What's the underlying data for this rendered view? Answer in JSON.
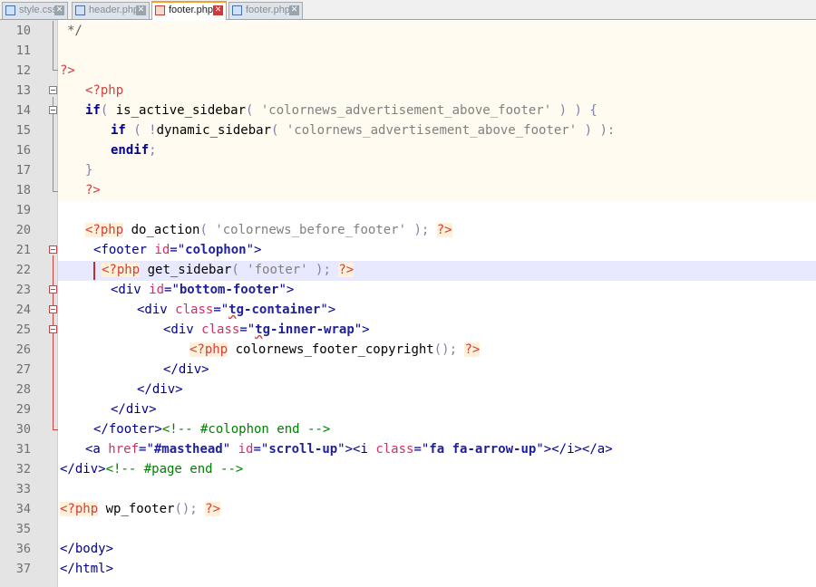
{
  "tabs": [
    {
      "label": "style.css",
      "active": false
    },
    {
      "label": "header.php",
      "active": false
    },
    {
      "label": "footer.php",
      "active": true
    },
    {
      "label": "footer.php",
      "active": false
    }
  ],
  "line_numbers": [
    "10",
    "11",
    "12",
    "13",
    "14",
    "15",
    "16",
    "17",
    "18",
    "19",
    "20",
    "21",
    "22",
    "23",
    "24",
    "25",
    "26",
    "27",
    "28",
    "29",
    "30",
    "31",
    "32",
    "33",
    "34",
    "35",
    "36",
    "37"
  ],
  "code": {
    "l10": {
      "a": "*/"
    },
    "l12": {
      "a": "?>"
    },
    "l13": {
      "a": "<?php"
    },
    "l14": {
      "a": "if",
      "b": "( ",
      "c": "is_active_sidebar",
      "d": "( ",
      "e": "'colornews_advertisement_above_footer'",
      "f": " ) ) {"
    },
    "l15": {
      "a": "if",
      "b": " ( !",
      "c": "dynamic_sidebar",
      "d": "( ",
      "e": "'colornews_advertisement_above_footer'",
      "f": " ) ):"
    },
    "l16": {
      "a": "endif",
      "b": ";"
    },
    "l17": {
      "a": "}"
    },
    "l18": {
      "a": "?>"
    },
    "l20": {
      "a": "<?php",
      "b": " do_action",
      "c": "( ",
      "d": "'colornews_before_footer'",
      "e": " ); ",
      "f": "?>"
    },
    "l21": {
      "a": "<footer ",
      "b": "id",
      "c": "=\"",
      "d": "colophon",
      "e": "\">"
    },
    "l22": {
      "a": "<?php",
      "b": " get_sidebar",
      "c": "( ",
      "d": "'footer'",
      "e": " ); ",
      "f": "?>"
    },
    "l23": {
      "a": "<div ",
      "b": "id",
      "c": "=\"",
      "d": "bottom-footer",
      "e": "\">"
    },
    "l24": {
      "a": "<div ",
      "b": "class",
      "c": "=\"",
      "d": "tg",
      "e": "-container",
      "f": "\">"
    },
    "l25": {
      "a": "<div ",
      "b": "class",
      "c": "=\"",
      "d": "tg",
      "e": "-inner-wrap",
      "f": "\">"
    },
    "l26": {
      "a": "<?php",
      "b": " colornews_footer_copyright",
      "c": "(); ",
      "d": "?>"
    },
    "l27": {
      "a": "</div>"
    },
    "l28": {
      "a": "</div>"
    },
    "l29": {
      "a": "</div>"
    },
    "l30": {
      "a": "</footer>",
      "b": "<!-- #colophon end -->"
    },
    "l31": {
      "a": "<a ",
      "b": "href",
      "c": "=\"",
      "d": "#masthead",
      "e": "\" ",
      "f": "id",
      "g": "=\"",
      "h": "scroll-up",
      "i": "\"><i ",
      "j": "class",
      "k": "=\"",
      "l": "fa fa-arrow-up",
      "m": "\"></i></a>"
    },
    "l32": {
      "a": "</div>",
      "b": "<!-- #page end -->"
    },
    "l34": {
      "a": "<?php",
      "b": " wp_footer",
      "c": "(); ",
      "d": "?>"
    },
    "l36": {
      "a": "</body>"
    },
    "l37": {
      "a": "</html>"
    }
  },
  "colors": {
    "php_tag": "#d04040",
    "keyword": "#00008b",
    "string": "#808080",
    "attribute": "#d0306a",
    "attr_value": "#20209a",
    "comment": "#008000",
    "current_line": "#e8e8ff",
    "php_block_bg": "#fffbf0",
    "gutter": "#e4e4e4"
  }
}
